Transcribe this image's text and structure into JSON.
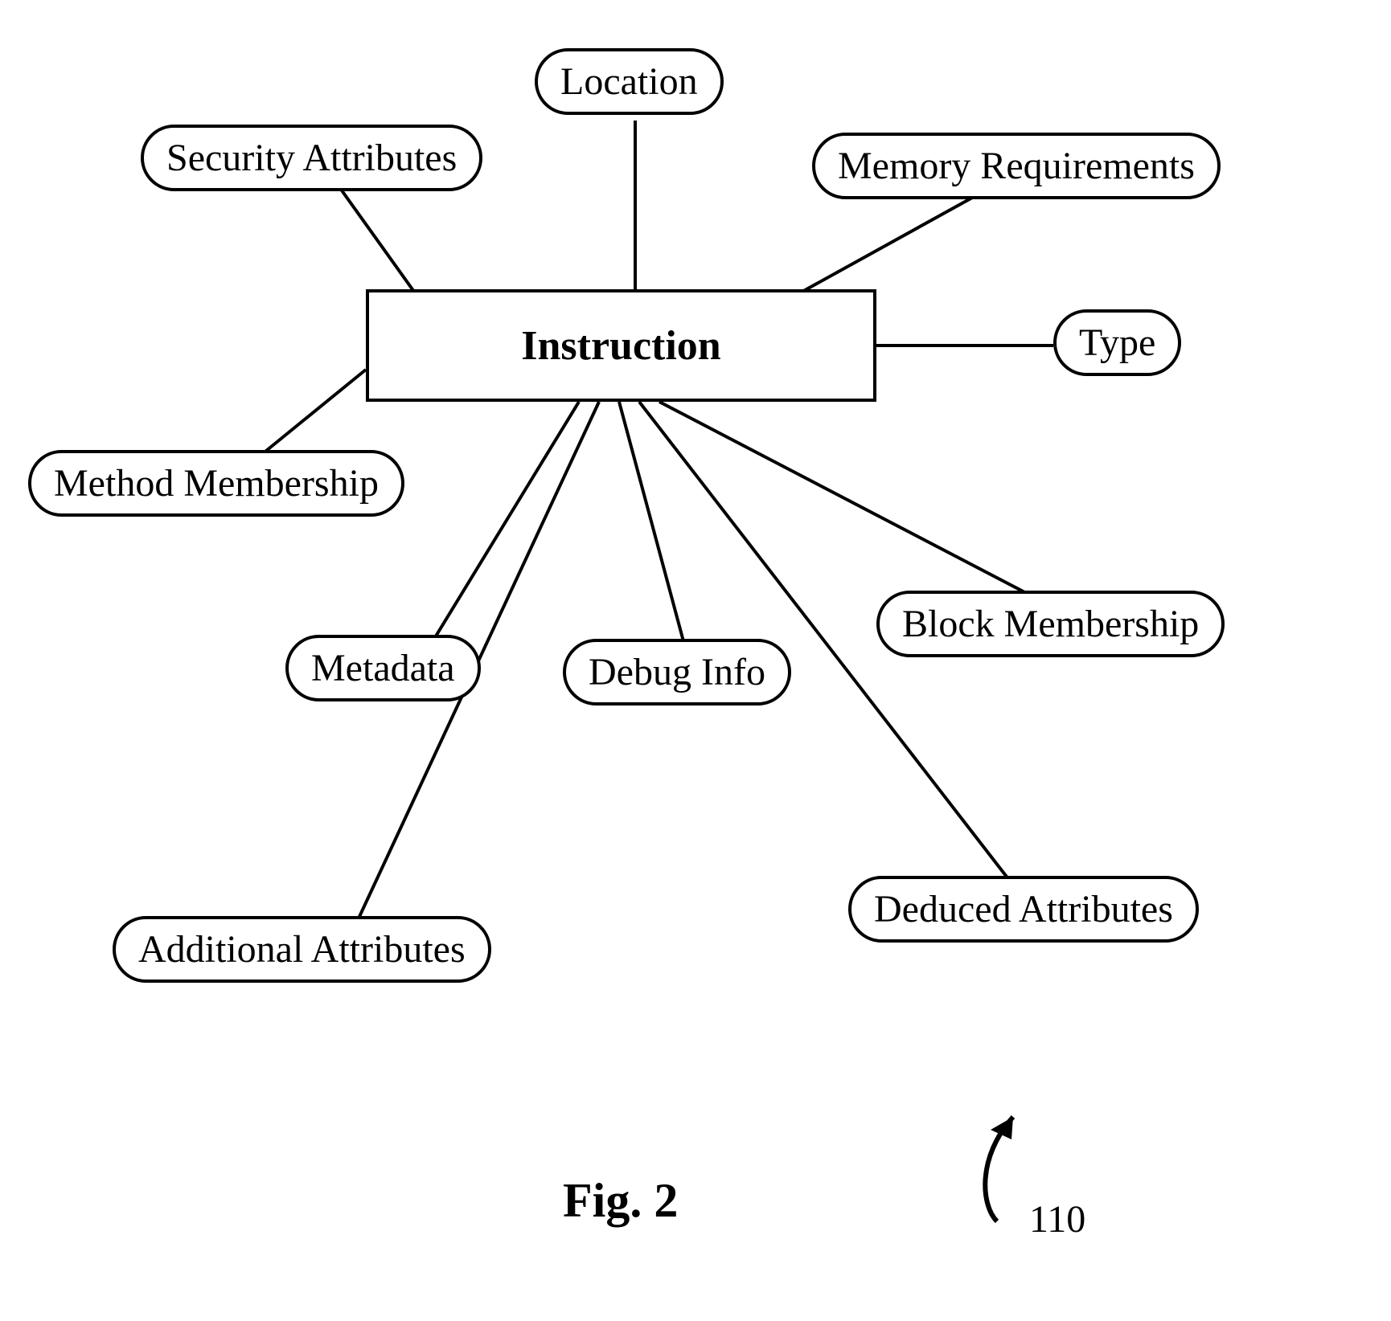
{
  "diagram": {
    "center": {
      "label": "Instruction"
    },
    "nodes": {
      "security_attributes": {
        "label": "Security Attributes"
      },
      "location": {
        "label": "Location"
      },
      "memory_requirements": {
        "label": "Memory Requirements"
      },
      "type": {
        "label": "Type"
      },
      "method_membership": {
        "label": "Method Membership"
      },
      "metadata": {
        "label": "Metadata"
      },
      "debug_info": {
        "label": "Debug Info"
      },
      "block_membership": {
        "label": "Block Membership"
      },
      "additional_attributes": {
        "label": "Additional Attributes"
      },
      "deduced_attributes": {
        "label": "Deduced Attributes"
      }
    },
    "caption": "Fig. 2",
    "reference_number": "110"
  }
}
